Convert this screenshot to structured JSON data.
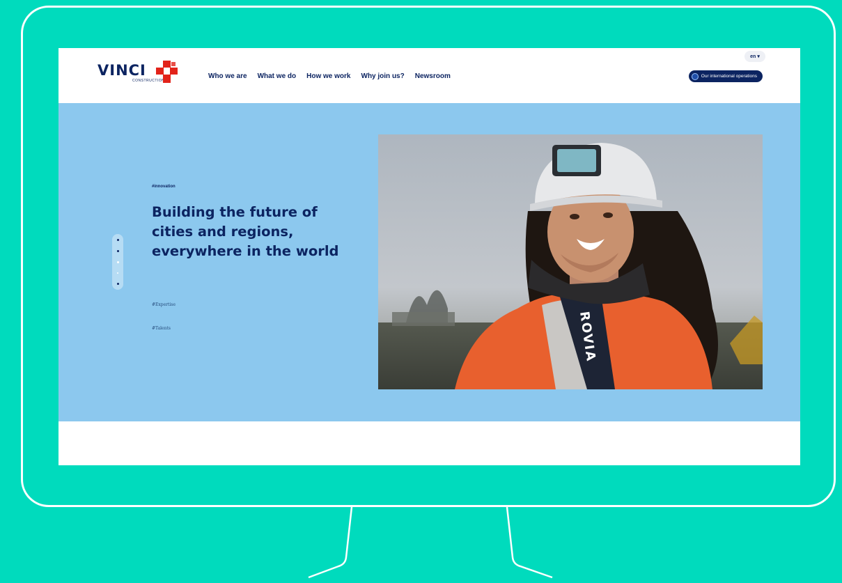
{
  "header": {
    "brand": "VINCI",
    "brand_sub": "CONSTRUCTION",
    "nav": [
      "Who we are",
      "What we do",
      "How we work",
      "Why join us?",
      "Newsroom"
    ],
    "language": "en",
    "international_button": "Our international operations"
  },
  "hero": {
    "eyebrow": "#innovation",
    "headline": "Building the future of cities and regions, everywhere in the world",
    "links": [
      "#Expertise",
      "#Talents"
    ],
    "vest_text": "ROVIA"
  },
  "colors": {
    "background": "#00dbbd",
    "hero": "#8cc8ee",
    "navy": "#0c2461",
    "logo_red": "#e2231a"
  },
  "icons": [
    "vinci-logo-mark",
    "globe-icon",
    "chevron-down-icon",
    "slider-dot"
  ]
}
